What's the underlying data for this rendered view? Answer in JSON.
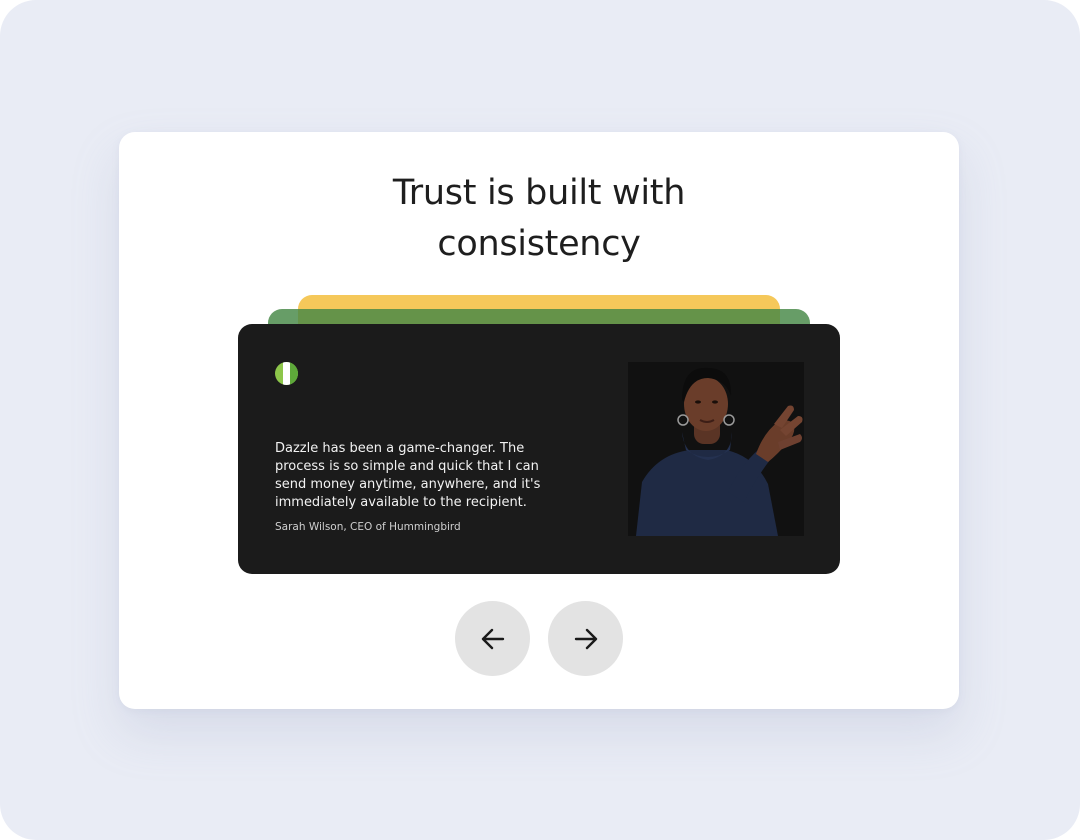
{
  "section": {
    "headline_line1": "Trust is built with",
    "headline_line2": "consistency"
  },
  "testimonial": {
    "quote": "Dazzle has been a game-changer. The process is so simple and quick that I can send money anytime, anywhere, and it's immediately available to the recipient.",
    "author": "Sarah Wilson, CEO of Hummingbird"
  },
  "controls": {
    "prev_icon": "arrow-left-icon",
    "next_icon": "arrow-right-icon"
  },
  "colors": {
    "background": "#e9ecf5",
    "card": "#1b1b1b",
    "stack_yellow": "#f5c85a",
    "stack_green": "#4a8a46",
    "logo_green": "#8dc64a",
    "nav_button": "#e3e3e3"
  }
}
